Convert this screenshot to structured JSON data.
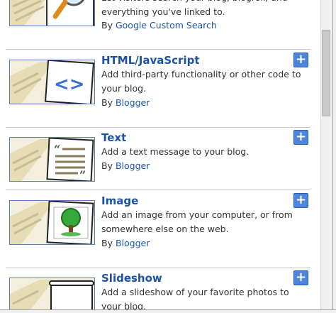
{
  "gadgets": [
    {
      "title": "",
      "desc": "Let visitors search your blog, blogroll, and everything you've linked to.",
      "by_label": "By",
      "author": "Google Custom Search",
      "icon": "magnifier-icon"
    },
    {
      "title": "HTML/JavaScript",
      "desc": "Add third-party functionality or other code to your blog.",
      "by_label": "By",
      "author": "Blogger",
      "icon": "code-brackets-icon"
    },
    {
      "title": "Text",
      "desc": "Add a text message to your blog.",
      "by_label": "By",
      "author": "Blogger",
      "icon": "text-quote-icon"
    },
    {
      "title": "Image",
      "desc": "Add an image from your computer, or from somewhere else on the web.",
      "by_label": "By",
      "author": "Blogger",
      "icon": "tree-picture-icon"
    },
    {
      "title": "Slideshow",
      "desc": "Add a slideshow of your favorite photos to your blog.",
      "by_label": "",
      "author": "",
      "icon": "projector-screen-icon"
    }
  ],
  "add_button_glyph": "+",
  "colors": {
    "title": "#1c52a6",
    "link": "#1a55b5",
    "add_button": "#4b86dc",
    "thumb_border": "#5a7fb7"
  }
}
